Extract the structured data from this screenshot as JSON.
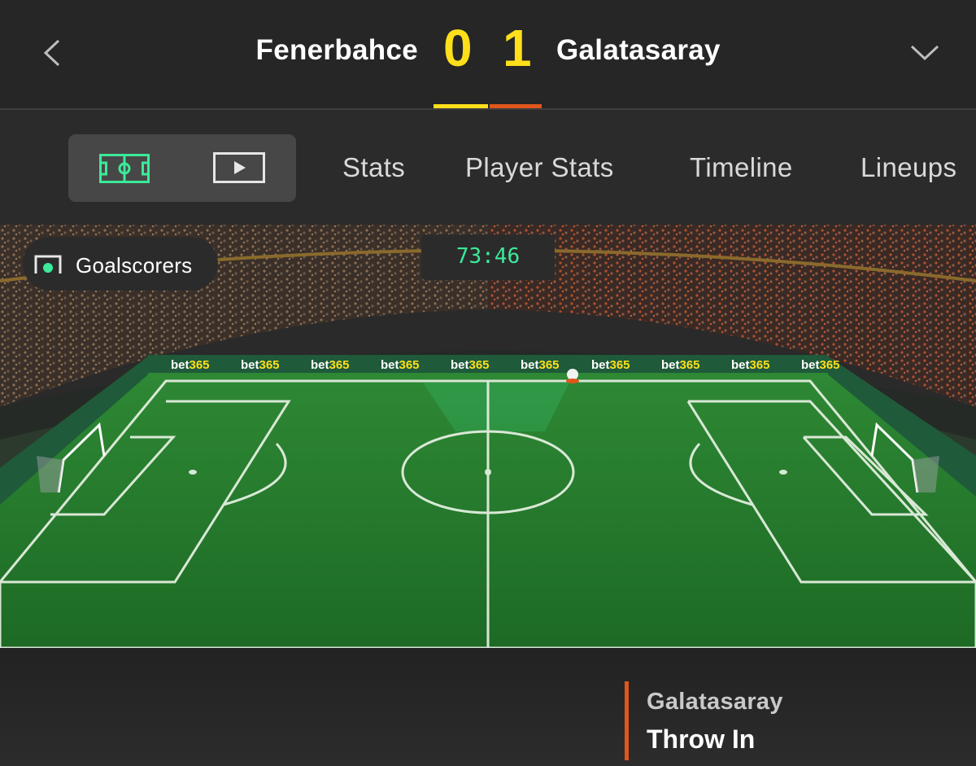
{
  "header": {
    "home_team": "Fenerbahce",
    "away_team": "Galatasaray",
    "home_score": "0",
    "away_score": "1",
    "home_color": "#ffdf1b",
    "away_color": "#e1561c",
    "back_icon": "chevron-left-icon",
    "expand_icon": "chevron-down-icon"
  },
  "view_toggle": {
    "pitch_icon": "pitch-icon",
    "video_icon": "play-video-icon"
  },
  "tabs": [
    "Stats",
    "Player Stats",
    "Timeline",
    "Lineups"
  ],
  "pitch": {
    "goalscorers_label": "Goalscorers",
    "goalscorers_icon": "goal-icon",
    "clock": "73:46",
    "advertising_board": "bet365",
    "accent_color": "#3bea9a"
  },
  "event": {
    "team": "Galatasaray",
    "type": "Throw In"
  }
}
